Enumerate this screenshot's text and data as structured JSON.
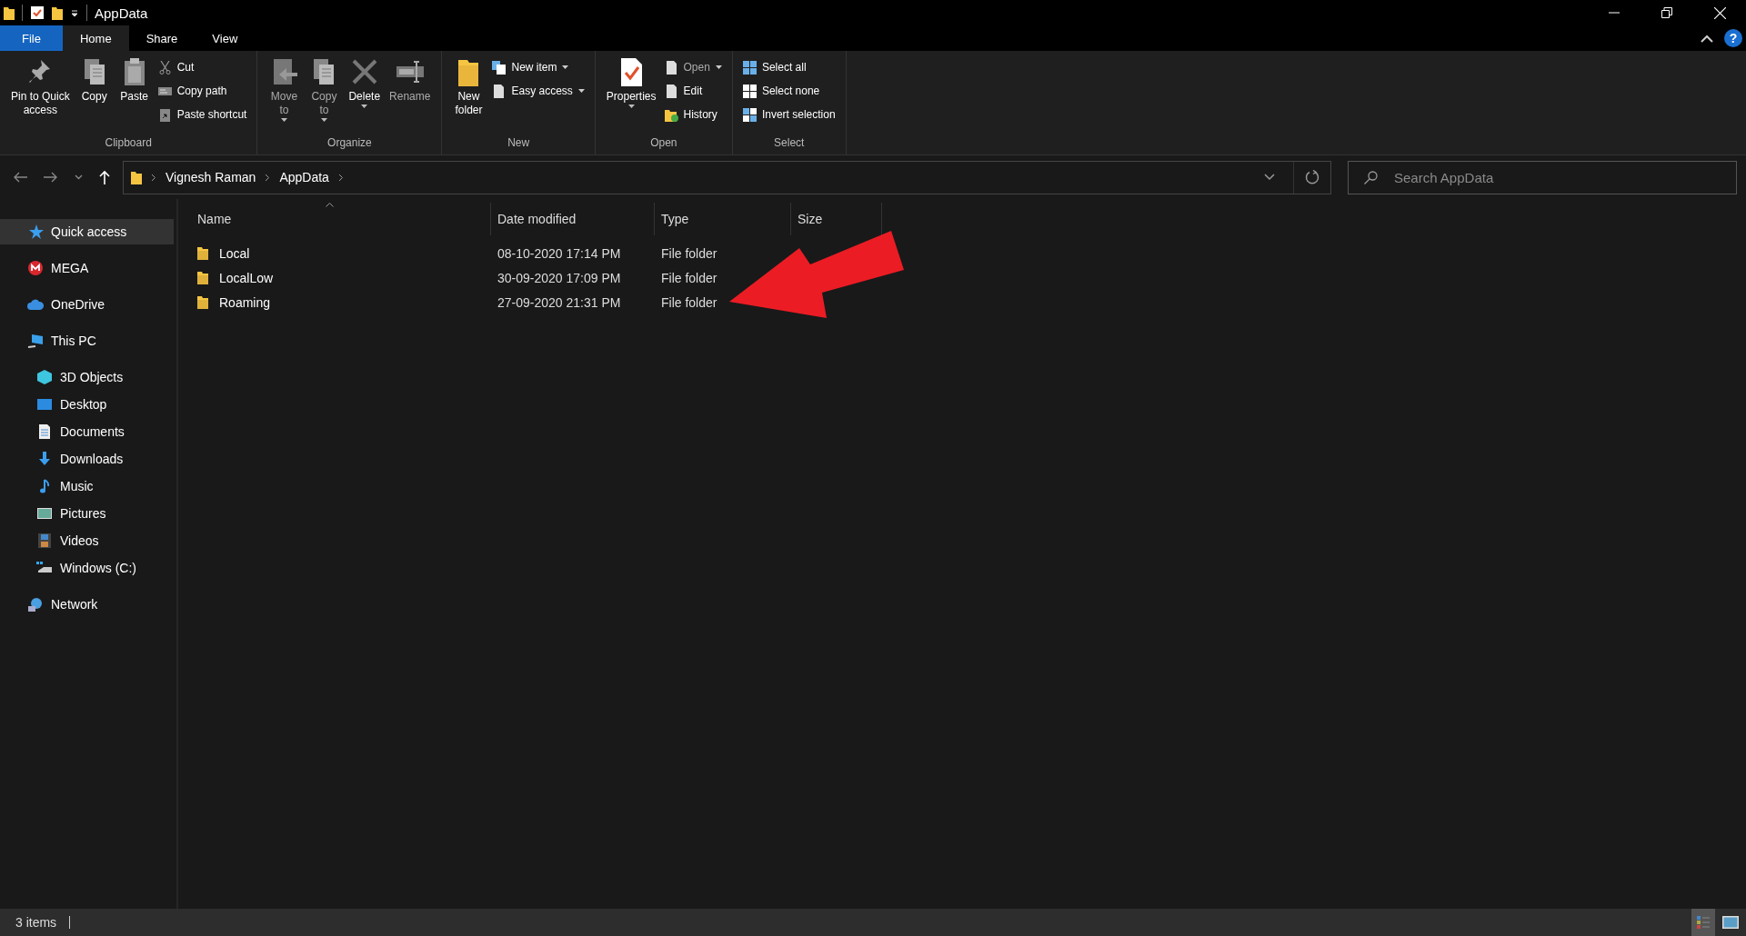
{
  "window": {
    "title": "AppData",
    "help": "?"
  },
  "tabs": [
    {
      "label": "File",
      "kind": "menu",
      "selected": false
    },
    {
      "label": "Home",
      "kind": "tab",
      "selected": true
    },
    {
      "label": "Share",
      "kind": "tab",
      "selected": false
    },
    {
      "label": "View",
      "kind": "tab",
      "selected": false
    }
  ],
  "ribbon": [
    {
      "label": "Clipboard",
      "items": [
        {
          "kind": "large",
          "label": "Pin to Quick\naccess",
          "dropdown": false,
          "disabled": false
        },
        {
          "kind": "large",
          "label": "Copy",
          "dropdown": false,
          "disabled": false
        },
        {
          "kind": "large",
          "label": "Paste",
          "dropdown": false,
          "disabled": false
        },
        {
          "kind": "small",
          "label": "Cut",
          "dropdown": false,
          "disabled": false
        },
        {
          "kind": "small",
          "label": "Copy path",
          "dropdown": false,
          "disabled": false
        },
        {
          "kind": "small",
          "label": "Paste shortcut",
          "dropdown": false,
          "disabled": false
        }
      ]
    },
    {
      "label": "Organize",
      "items": [
        {
          "kind": "large",
          "label": "Move\nto",
          "dropdown": true,
          "disabled": true
        },
        {
          "kind": "large",
          "label": "Copy\nto",
          "dropdown": true,
          "disabled": true
        },
        {
          "kind": "large",
          "label": "Delete",
          "dropdown": true,
          "disabled": false
        },
        {
          "kind": "large",
          "label": "Rename",
          "dropdown": false,
          "disabled": true
        }
      ]
    },
    {
      "label": "New",
      "items": [
        {
          "kind": "large",
          "label": "New\nfolder",
          "dropdown": false,
          "disabled": false
        },
        {
          "kind": "small",
          "label": "New item",
          "dropdown": true,
          "disabled": false
        },
        {
          "kind": "small",
          "label": "Easy access",
          "dropdown": true,
          "disabled": false
        }
      ]
    },
    {
      "label": "Open",
      "items": [
        {
          "kind": "large",
          "label": "Properties",
          "dropdown": true,
          "disabled": false
        },
        {
          "kind": "small",
          "label": "Open",
          "dropdown": true,
          "disabled": true
        },
        {
          "kind": "small",
          "label": "Edit",
          "dropdown": false,
          "disabled": false
        },
        {
          "kind": "small",
          "label": "History",
          "dropdown": false,
          "disabled": false
        }
      ]
    },
    {
      "label": "Select",
      "items": [
        {
          "kind": "small",
          "label": "Select all",
          "dropdown": false,
          "disabled": false
        },
        {
          "kind": "small",
          "label": "Select none",
          "dropdown": false,
          "disabled": false
        },
        {
          "kind": "small",
          "label": "Invert selection",
          "dropdown": false,
          "disabled": false
        }
      ]
    }
  ],
  "address": {
    "crumbs": [
      "Vignesh Raman",
      "AppData"
    ]
  },
  "search": {
    "placeholder": "Search AppData"
  },
  "nav": [
    {
      "label": "Quick access",
      "selected": true
    },
    {
      "label": "MEGA",
      "selected": false
    },
    {
      "label": "OneDrive",
      "selected": false
    },
    {
      "label": "This PC",
      "selected": false,
      "children": [
        {
          "label": "3D Objects",
          "selected": false
        },
        {
          "label": "Desktop",
          "selected": false
        },
        {
          "label": "Documents",
          "selected": false
        },
        {
          "label": "Downloads",
          "selected": false
        },
        {
          "label": "Music",
          "selected": false
        },
        {
          "label": "Pictures",
          "selected": false
        },
        {
          "label": "Videos",
          "selected": false
        },
        {
          "label": "Windows (C:)",
          "selected": false
        }
      ]
    },
    {
      "label": "Network",
      "selected": false
    }
  ],
  "columns": [
    {
      "label": "Name",
      "sorted": true
    },
    {
      "label": "Date modified",
      "sorted": false
    },
    {
      "label": "Type",
      "sorted": false
    },
    {
      "label": "Size",
      "sorted": false
    }
  ],
  "rows": [
    {
      "name": "Local",
      "date": "08-10-2020 17:14  PM",
      "type": "File folder"
    },
    {
      "name": "LocalLow",
      "date": "30-09-2020 17:09  PM",
      "type": "File folder"
    },
    {
      "name": "Roaming",
      "date": "27-09-2020 21:31  PM",
      "type": "File folder"
    }
  ],
  "status_bar": {
    "text": "3 items",
    "views": [
      {
        "selected": true
      },
      {
        "selected": false
      }
    ]
  }
}
